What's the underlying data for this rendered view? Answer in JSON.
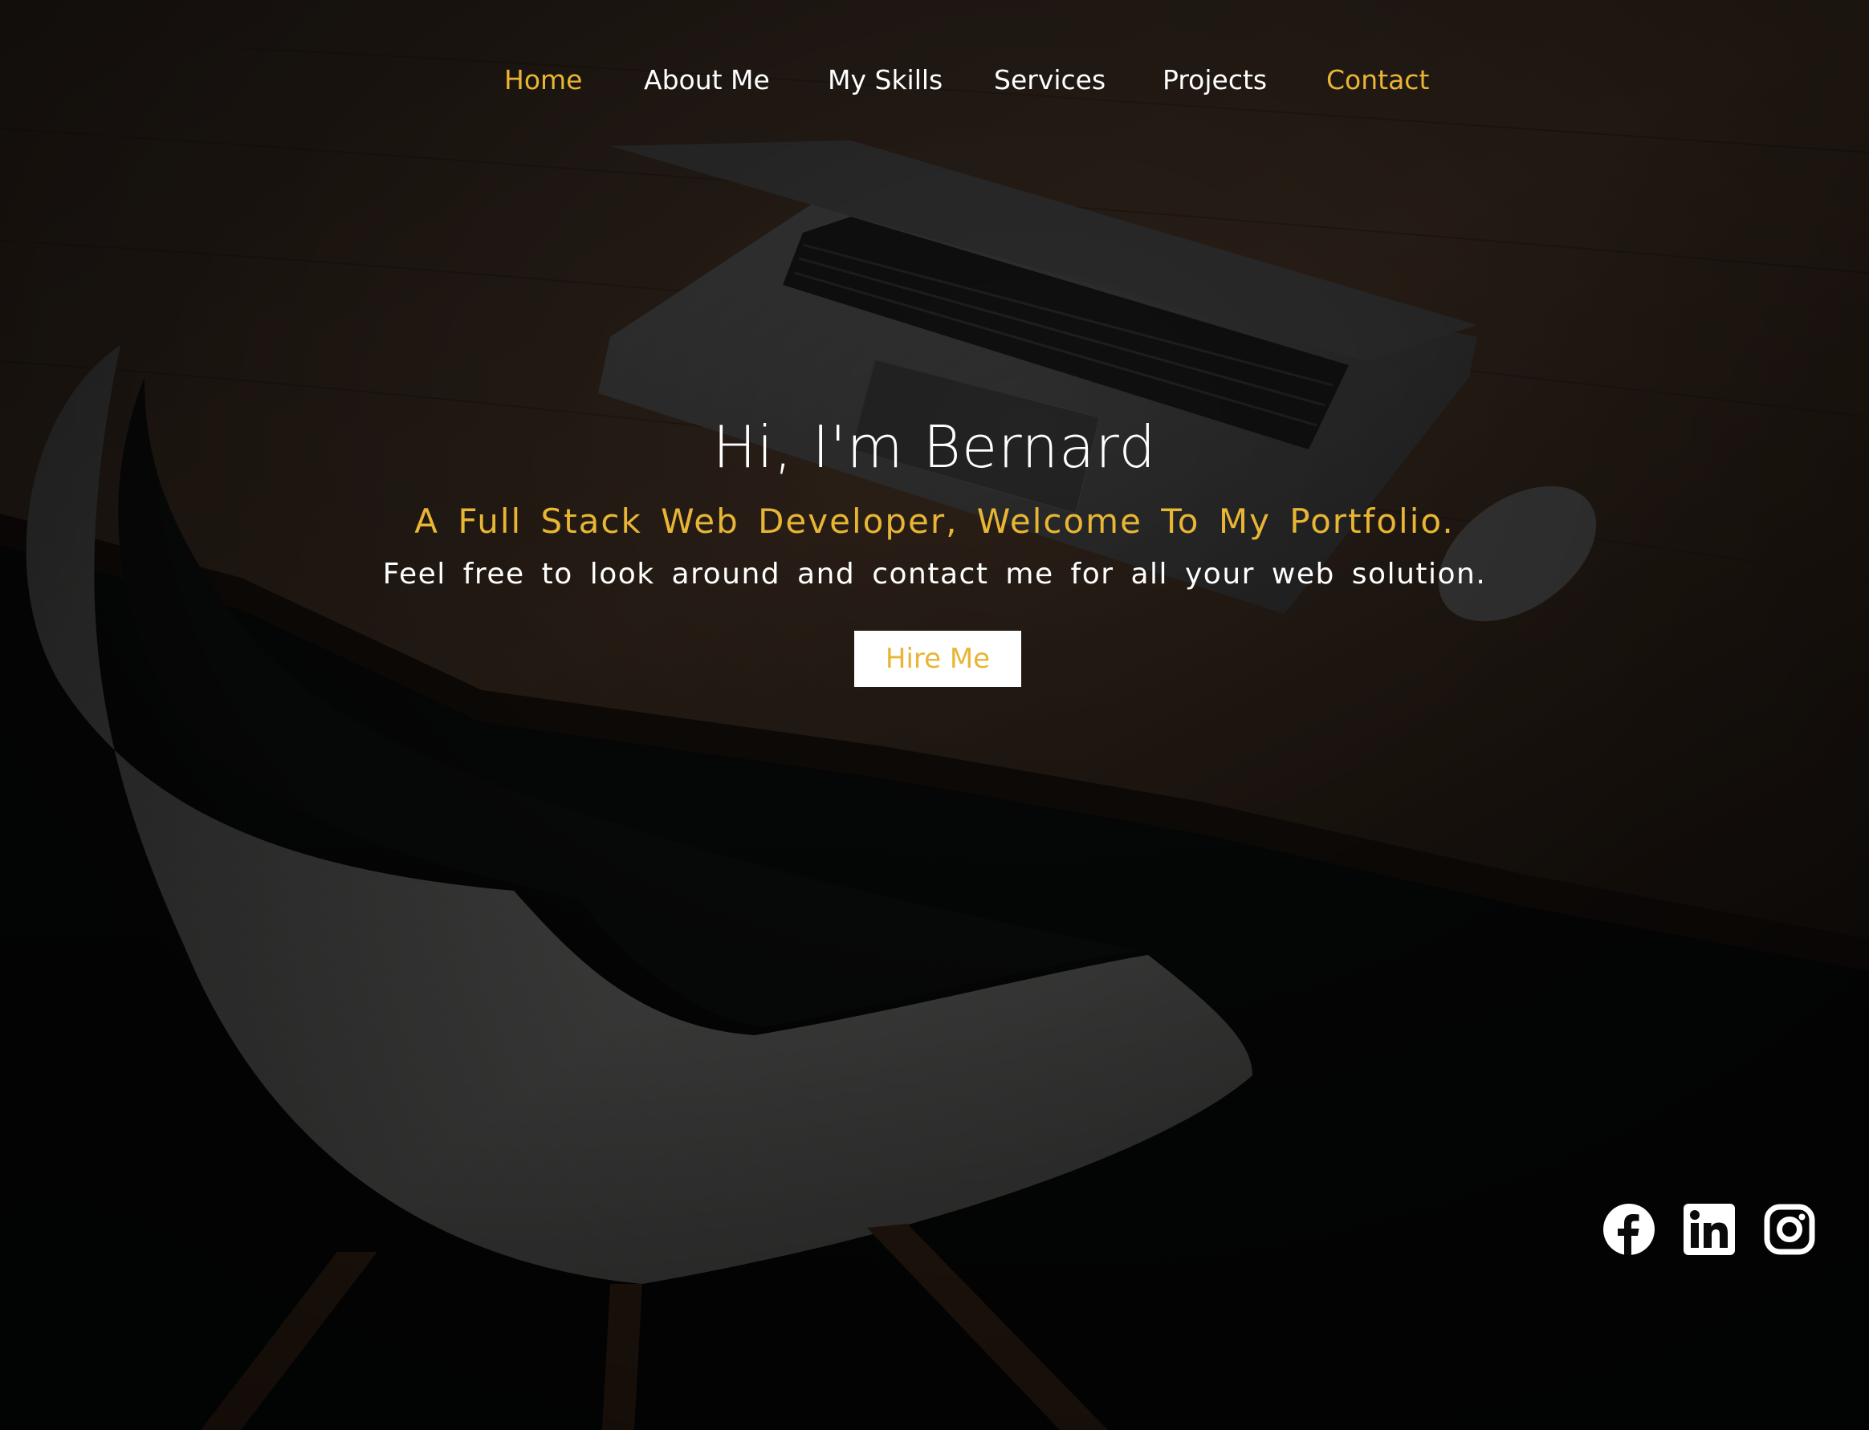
{
  "nav": {
    "items": [
      {
        "label": "Home",
        "active": true
      },
      {
        "label": "About Me"
      },
      {
        "label": "My Skills"
      },
      {
        "label": "Services"
      },
      {
        "label": "Projects"
      },
      {
        "label": "Contact",
        "accent": true
      }
    ]
  },
  "hero": {
    "title": "Hi, I'm Bernard",
    "subtitle": "A Full Stack Web Developer, Welcome To My Portfolio.",
    "description": "Feel free to look around and contact me for all your web solution.",
    "cta_label": "Hire Me"
  },
  "social": {
    "icons": [
      "facebook-icon",
      "linkedin-icon",
      "instagram-icon"
    ]
  },
  "colors": {
    "accent": "#e8b535",
    "text": "#ffffff",
    "background": "#0a0a0a",
    "button_bg": "#ffffff"
  }
}
